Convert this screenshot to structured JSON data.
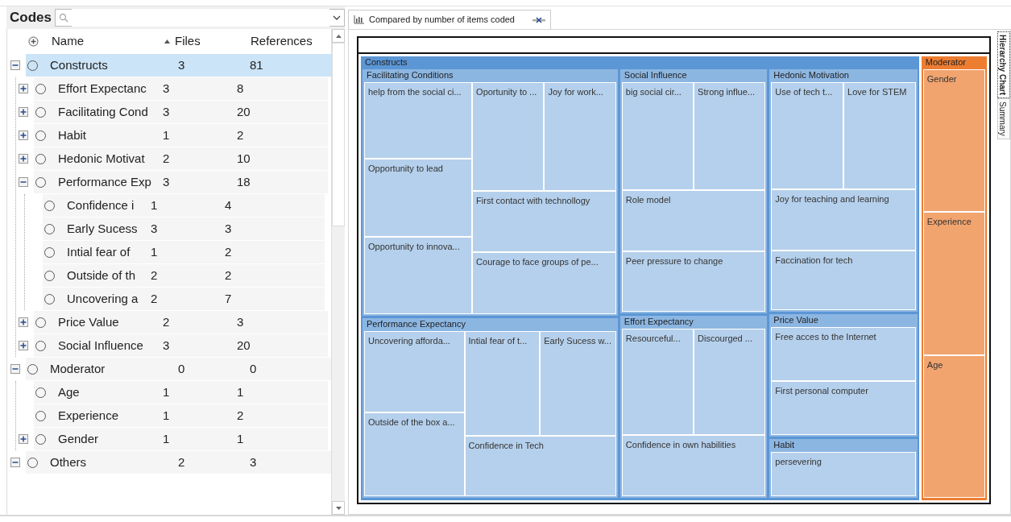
{
  "codes_panel": {
    "title": "Codes",
    "columns": [
      {
        "label": "Name"
      },
      {
        "label": "Files",
        "sorted": true
      },
      {
        "label": "References"
      }
    ],
    "tree": [
      {
        "name": "Constructs",
        "files": "3",
        "references": "81",
        "expanded": true,
        "selected": true,
        "children": [
          {
            "name": "Effort Expectanc",
            "files": "3",
            "references": "8",
            "expanded": false,
            "selected": false
          },
          {
            "name": "Facilitating Cond",
            "files": "3",
            "references": "20",
            "expanded": false,
            "selected": false
          },
          {
            "name": "Habit",
            "files": "1",
            "references": "2",
            "expanded": false,
            "selected": false
          },
          {
            "name": "Hedonic Motivat",
            "files": "2",
            "references": "10",
            "expanded": false,
            "selected": false
          },
          {
            "name": "Performance Exp",
            "files": "3",
            "references": "18",
            "expanded": true,
            "selected": false,
            "children": [
              {
                "name": "Confidence i",
                "files": "1",
                "references": "4",
                "selected": false
              },
              {
                "name": "Early Sucess",
                "files": "3",
                "references": "3",
                "selected": false
              },
              {
                "name": "Intial fear of",
                "files": "1",
                "references": "2",
                "selected": false
              },
              {
                "name": "Outside of th",
                "files": "2",
                "references": "2",
                "selected": false
              },
              {
                "name": "Uncovering a",
                "files": "2",
                "references": "7",
                "selected": false
              }
            ]
          },
          {
            "name": "Price Value",
            "files": "2",
            "references": "3",
            "expanded": false,
            "selected": false
          },
          {
            "name": "Social Influence",
            "files": "3",
            "references": "20",
            "expanded": false,
            "selected": false
          }
        ]
      },
      {
        "name": "Moderator",
        "files": "0",
        "references": "0",
        "expanded": true,
        "selected": false,
        "children": [
          {
            "name": "Age",
            "files": "1",
            "references": "1",
            "selected": false
          },
          {
            "name": "Experience",
            "files": "1",
            "references": "2",
            "selected": false
          },
          {
            "name": "Gender",
            "files": "1",
            "references": "1",
            "expanded": false,
            "selected": false
          }
        ]
      },
      {
        "name": "Others",
        "files": "2",
        "references": "3",
        "expanded": true,
        "selected": false
      }
    ]
  },
  "chart_panel": {
    "tab": {
      "label": "Compared by number of items coded"
    },
    "side_tabs": [
      {
        "label": "Hierarchy Chart",
        "selected": true
      },
      {
        "label": "Summary",
        "selected": false
      }
    ],
    "treemap": [
      {
        "label": "Constructs",
        "color": "#5b96d5",
        "children": [
          {
            "label": "Facilitating Conditions",
            "tiles": [
              {
                "label": "help from the social ci..."
              },
              {
                "label": "Oportunity to ..."
              },
              {
                "label": "Joy for work..."
              },
              {
                "label": "Opportunity to lead"
              },
              {
                "label": "First contact with technollogy"
              },
              {
                "label": "Opportunity to innova..."
              },
              {
                "label": "Courage to face groups of pe..."
              }
            ]
          },
          {
            "label": "Social Influence",
            "tiles": [
              {
                "label": "big social cir..."
              },
              {
                "label": "Strong influe..."
              },
              {
                "label": "Role model"
              },
              {
                "label": "Peer pressure to change"
              }
            ]
          },
          {
            "label": "Hedonic Motivation",
            "tiles": [
              {
                "label": "Use of tech t..."
              },
              {
                "label": "Love for STEM"
              },
              {
                "label": "Joy for teaching and learning"
              },
              {
                "label": "Faccination for tech"
              }
            ]
          },
          {
            "label": "Performance Expectancy",
            "tiles": [
              {
                "label": "Uncovering afforda..."
              },
              {
                "label": "Intial fear of t..."
              },
              {
                "label": "Early Sucess w..."
              },
              {
                "label": "Outside of the box a..."
              },
              {
                "label": "Confidence in Tech"
              }
            ]
          },
          {
            "label": "Effort Expectancy",
            "tiles": [
              {
                "label": "Resourceful..."
              },
              {
                "label": "Discourged ..."
              },
              {
                "label": "Confidence in own habilities"
              }
            ]
          },
          {
            "label": "Price Value",
            "tiles": [
              {
                "label": "Free acces to the Internet"
              },
              {
                "label": "First personal computer"
              }
            ]
          },
          {
            "label": "Habit",
            "tiles": [
              {
                "label": "persevering"
              }
            ]
          }
        ]
      },
      {
        "label": "Moderator",
        "color": "#ed7d31",
        "tiles": [
          {
            "label": "Gender"
          },
          {
            "label": "Experience"
          },
          {
            "label": "Age"
          }
        ]
      }
    ]
  }
}
